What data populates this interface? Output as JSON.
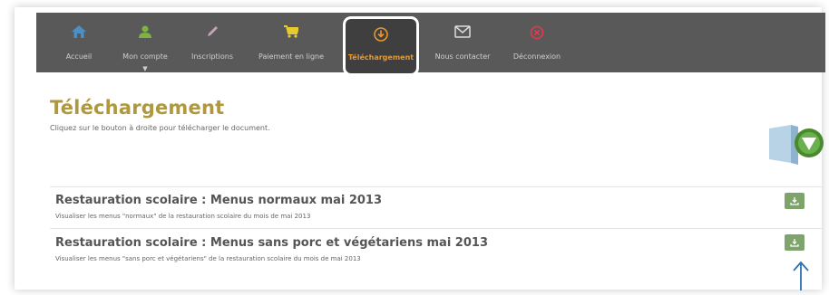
{
  "nav": {
    "items": [
      {
        "label": "Accueil",
        "icon": "home-icon",
        "color": "#4d8fc4"
      },
      {
        "label": "Mon compte",
        "icon": "user-icon",
        "color": "#7cb342"
      },
      {
        "label": "Inscriptions",
        "icon": "pencil-icon",
        "color": "#c7a3b8"
      },
      {
        "label": "Paiement en ligne",
        "icon": "cart-icon",
        "color": "#e8c92e"
      },
      {
        "label": "Téléchargement",
        "icon": "download-circle-icon",
        "color": "#e8972e",
        "active": true
      },
      {
        "label": "Nous contacter",
        "icon": "mail-icon",
        "color": "#dddddd"
      },
      {
        "label": "Déconnexion",
        "icon": "logout-icon",
        "color": "#e53950"
      }
    ]
  },
  "page": {
    "title": "Téléchargement",
    "subtitle": "Cliquez sur le bouton à droite pour télécharger le document."
  },
  "documents": [
    {
      "title": "Restauration scolaire : Menus normaux mai 2013",
      "description": "Visualiser les menus \"normaux\" de la restauration scolaire du mois de mai 2013"
    },
    {
      "title": "Restauration scolaire : Menus sans porc et végétariens mai 2013",
      "description": "Visualiser les menus \"sans porc et végétariens\" de la restauration scolaire du mois de mai 2013"
    }
  ],
  "colors": {
    "title": "#b0983e",
    "navbar": "#595959",
    "download_button": "#7ea36b",
    "annotation_arrow": "#2f6fb0"
  }
}
